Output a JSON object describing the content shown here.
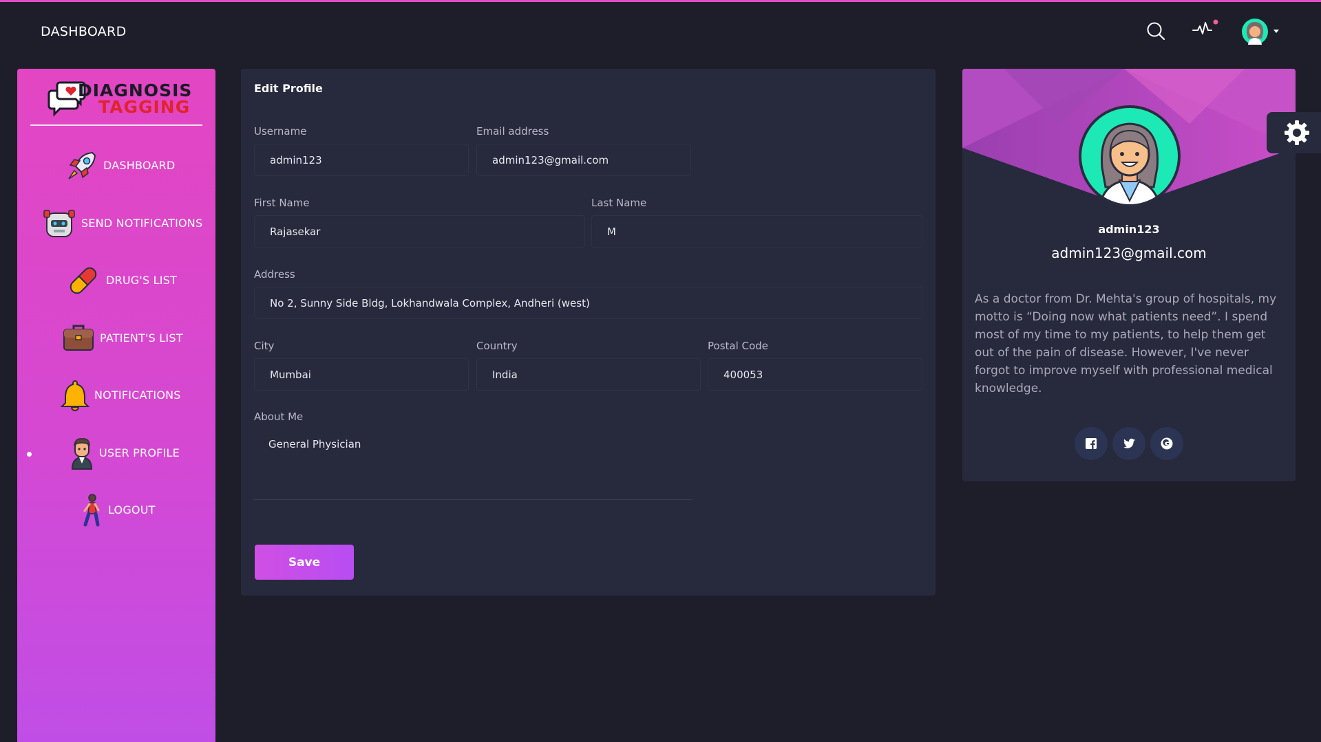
{
  "navbar": {
    "brand": "DASHBOARD",
    "icons": [
      "search-icon",
      "activity-pulse-icon",
      "user-avatar-icon"
    ],
    "notification_dot_color": "#fd5d93"
  },
  "sidebar": {
    "logo": {
      "line1": "DIAGNOSIS",
      "line2": "TAGGING"
    },
    "items": [
      {
        "label": "DASHBOARD",
        "icon": "rocket-icon"
      },
      {
        "label": "SEND NOTIFICATIONS",
        "icon": "robot-icon"
      },
      {
        "label": "DRUG'S LIST",
        "icon": "pill-icon"
      },
      {
        "label": "PATIENT'S LIST",
        "icon": "briefcase-icon"
      },
      {
        "label": "NOTIFICATIONS",
        "icon": "bell-icon"
      },
      {
        "label": "USER PROFILE",
        "icon": "user-icon",
        "active": true
      },
      {
        "label": "LOGOUT",
        "icon": "walking-person-icon"
      }
    ]
  },
  "edit_profile": {
    "title": "Edit Profile",
    "fields": {
      "username": {
        "label": "Username",
        "value": "admin123"
      },
      "email": {
        "label": "Email address",
        "value": "admin123@gmail.com"
      },
      "first_name": {
        "label": "First Name",
        "value": "Rajasekar"
      },
      "last_name": {
        "label": "Last Name",
        "value": "M"
      },
      "address": {
        "label": "Address",
        "value": "No 2, Sunny Side Bldg, Lokhandwala Complex, Andheri (west)"
      },
      "city": {
        "label": "City",
        "value": "Mumbai"
      },
      "country": {
        "label": "Country",
        "value": "India"
      },
      "postal_code": {
        "label": "Postal Code",
        "value": "400053"
      },
      "about": {
        "label": "About Me",
        "value": "General Physician"
      }
    },
    "save_label": "Save"
  },
  "user_card": {
    "name": "admin123",
    "email": "admin123@gmail.com",
    "description": "As a doctor from Dr. Mehta's group of hospitals, my motto is “Doing now what patients need”. I spend most of my time to my patients, to help them get out of the pain of disease. However, I've never forgot to improve myself with professional medical knowledge.",
    "socials": [
      "facebook-icon",
      "twitter-icon",
      "google-icon"
    ]
  },
  "colors": {
    "accent": "#e14eca",
    "background": "#1e1e2b",
    "card": "#27293d",
    "save_button": "#c24ff0",
    "avatar_bg": "#1de9b6"
  }
}
